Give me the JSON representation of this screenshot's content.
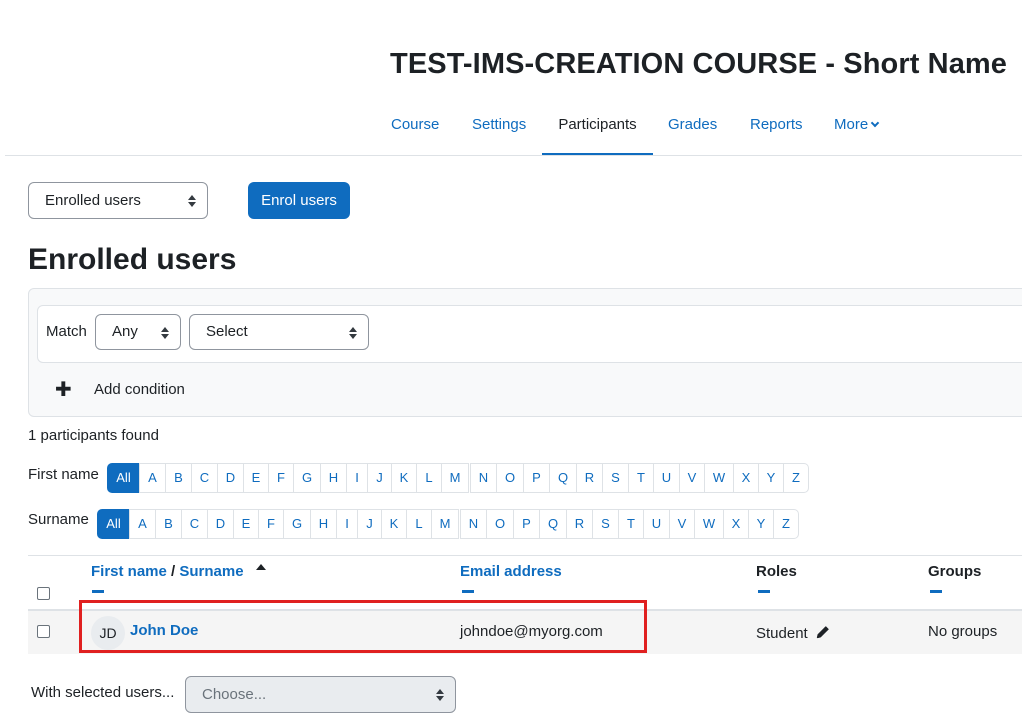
{
  "course": {
    "title": "TEST-IMS-CREATION COURSE - Short Name"
  },
  "nav": {
    "items": [
      {
        "label": "Course",
        "active": false
      },
      {
        "label": "Settings",
        "active": false
      },
      {
        "label": "Participants",
        "active": true
      },
      {
        "label": "Grades",
        "active": false
      },
      {
        "label": "Reports",
        "active": false
      },
      {
        "label": "More",
        "active": false
      }
    ]
  },
  "toolbar": {
    "view_select": "Enrolled users",
    "enrol_button": "Enrol users"
  },
  "page": {
    "heading": "Enrolled users"
  },
  "filter": {
    "match_label": "Match",
    "match_value": "Any",
    "type_value": "Select",
    "add_condition": "Add condition"
  },
  "summary": {
    "count_text": "1 participants found"
  },
  "initials": {
    "firstname_label": "First name",
    "surname_label": "Surname",
    "all_label": "All",
    "letters": [
      "A",
      "B",
      "C",
      "D",
      "E",
      "F",
      "G",
      "H",
      "I",
      "J",
      "K",
      "L",
      "M",
      "N",
      "O",
      "P",
      "Q",
      "R",
      "S",
      "T",
      "U",
      "V",
      "W",
      "X",
      "Y",
      "Z"
    ]
  },
  "table": {
    "headers": {
      "firstname": "First name",
      "separator": "/",
      "surname": "Surname",
      "email": "Email address",
      "roles": "Roles",
      "groups": "Groups"
    },
    "rows": [
      {
        "initials": "JD",
        "name": "John Doe",
        "email": "johndoe@myorg.com",
        "role": "Student",
        "groups": "No groups"
      }
    ]
  },
  "bulk": {
    "label": "With selected users...",
    "placeholder": "Choose..."
  },
  "colors": {
    "accent": "#0f6cbf",
    "highlight": "#e02020"
  }
}
